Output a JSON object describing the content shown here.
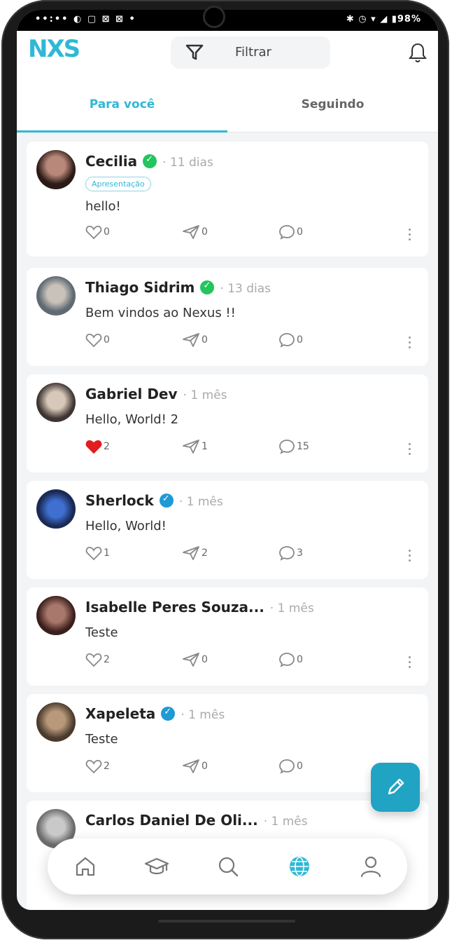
{
  "status": {
    "left": "••:•• ◐ ▢ ⊠ ⊠  •",
    "right": "✱ ◷ ▾ ◢ ▮98%"
  },
  "header": {
    "logo": "NXS",
    "filter_label": "Filtrar"
  },
  "tabs": [
    {
      "label": "Para você",
      "active": true
    },
    {
      "label": "Seguindo",
      "active": false
    }
  ],
  "posts": [
    {
      "name": "Cecilia",
      "verified": true,
      "badge_color": "#22c55e",
      "time": "· 11 dias",
      "tag": "Apresentação",
      "text": "hello!",
      "likes": "0",
      "shares": "0",
      "comments": "0",
      "liked": false,
      "avatar_colors": [
        "#2b1a16",
        "#b9887a"
      ]
    },
    {
      "name": "Thiago Sidrim",
      "verified": true,
      "badge_color": "#22c55e",
      "time": "· 13 dias",
      "text": "Bem vindos ao Nexus !!",
      "likes": "0",
      "shares": "0",
      "comments": "0",
      "liked": false,
      "avatar_colors": [
        "#5f6a72",
        "#c9c2ba"
      ]
    },
    {
      "name": "Gabriel Dev",
      "verified": false,
      "time": "· 1 mês",
      "text": "Hello, World! 2",
      "likes": "2",
      "shares": "1",
      "comments": "15",
      "liked": true,
      "avatar_colors": [
        "#3e3532",
        "#d7c8b9"
      ]
    },
    {
      "name": "Sherlock",
      "verified": true,
      "badge_color": "#1e9ad6",
      "time": "· 1 mês",
      "text": "Hello, World!",
      "likes": "1",
      "shares": "2",
      "comments": "3",
      "liked": false,
      "avatar_colors": [
        "#1a2a55",
        "#3f6fd1"
      ]
    },
    {
      "name": "Isabelle Peres Souza...",
      "verified": false,
      "time": "· 1 mês",
      "text": "Teste",
      "likes": "2",
      "shares": "0",
      "comments": "0",
      "liked": false,
      "avatar_colors": [
        "#3a1f1c",
        "#a9776b"
      ]
    },
    {
      "name": "Xapeleta",
      "verified": true,
      "badge_color": "#1e9ad6",
      "time": "· 1 mês",
      "text": "Teste",
      "likes": "2",
      "shares": "0",
      "comments": "0",
      "liked": false,
      "avatar_colors": [
        "#4a3a2e",
        "#b89a7a"
      ]
    },
    {
      "name": "Carlos Daniel De Oli...",
      "verified": false,
      "time": "· 1 mês",
      "text": "",
      "likes": "",
      "shares": "",
      "comments": "",
      "liked": false,
      "avatar_colors": [
        "#6b6b6b",
        "#c9c9c9"
      ]
    }
  ],
  "colors": {
    "accent": "#30b8d6",
    "like_active": "#e11d1d"
  },
  "nav_icons": [
    "home-icon",
    "graduation-cap-icon",
    "search-icon",
    "globe-icon",
    "profile-icon"
  ],
  "fab_icon": "pencil-icon"
}
